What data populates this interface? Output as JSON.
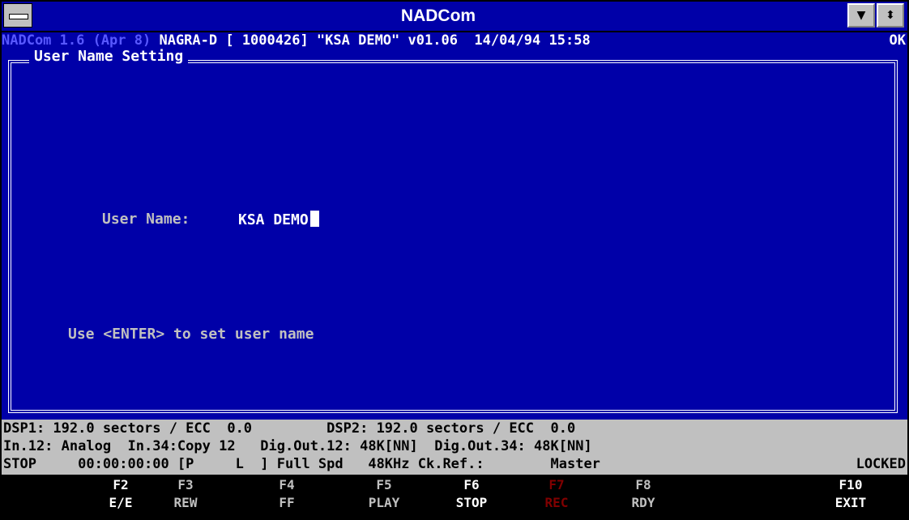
{
  "window": {
    "title": "NADCom"
  },
  "status": {
    "app": "NADCom 1.6 (Apr 8)",
    "info": " NAGRA-D [ 1000426] \"KSA DEMO\" v01.06  14/04/94 15:58",
    "ok": "OK"
  },
  "panel": {
    "title": "User Name Setting",
    "field_label": "User Name:",
    "field_value": "KSA DEMO",
    "hint": "Use <ENTER> to set user name"
  },
  "info": {
    "row1": "DSP1: 192.0 sectors / ECC  0.0         DSP2: 192.0 sectors / ECC  0.0",
    "row2": "In.12: Analog  In.34:Copy 12   Dig.Out.12: 48K[NN]  Dig.Out.34: 48K[NN]",
    "row3": "STOP     00:00:00:00 [P     L  ] Full Spd   48KHz Ck.Ref.:        Master",
    "locked": "LOCKED"
  },
  "fkeys": [
    {
      "key": "F2",
      "label": "E/E",
      "state": "on"
    },
    {
      "key": "F3",
      "label": "REW",
      "state": "dim"
    },
    {
      "key": "F4",
      "label": "FF",
      "state": "dim"
    },
    {
      "key": "F5",
      "label": "PLAY",
      "state": "dim"
    },
    {
      "key": "F6",
      "label": "STOP",
      "state": "on"
    },
    {
      "key": "F7",
      "label": "REC",
      "state": "rec"
    },
    {
      "key": "F8",
      "label": "RDY",
      "state": "dim"
    },
    {
      "key": "F10",
      "label": "EXIT",
      "state": "on"
    }
  ],
  "colors": {
    "background": "#0000a8",
    "frame": "#ffffff",
    "info_bar": "#c0c0c0",
    "rec_key": "#800000"
  }
}
